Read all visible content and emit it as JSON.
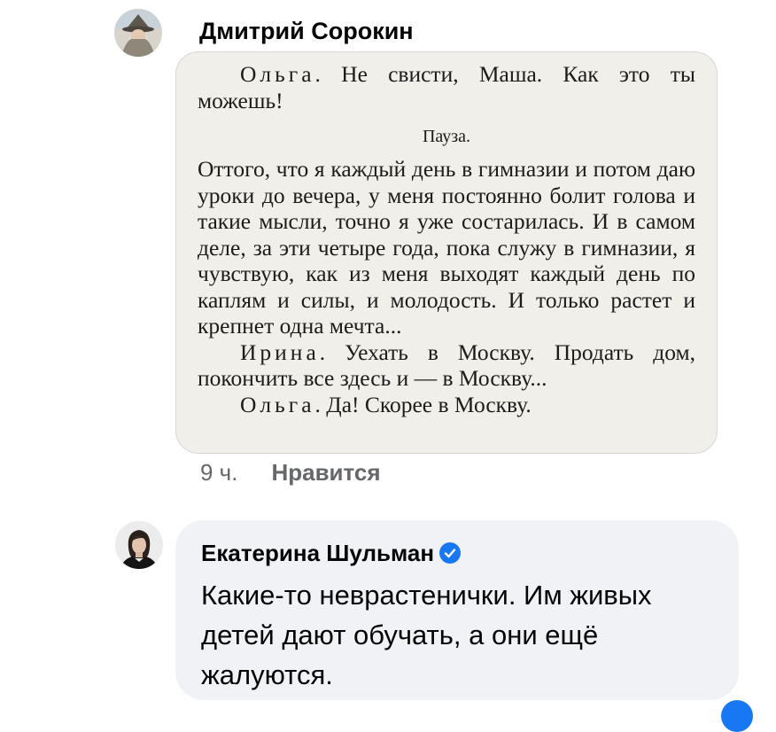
{
  "comment1": {
    "author": "Дмитрий Сорокин",
    "avatar_icon": "wizard-avatar",
    "photo": {
      "line1_speaker": "Ольга",
      "line1_text": ". Не свисти, Маша. Как это ты можешь!",
      "pause": "Пауза.",
      "paragraph": "Оттого, что я каждый день в гимназии и потом даю уроки до вечера, у меня постоянно болит голова и такие мысли, точно я уже состарилась. И в самом деле, за эти четыре года, пока служу в гимназии, я чувствую, как из меня выходят каждый день по каплям и силы, и молодость. И только растет и крепнет одна мечта...",
      "line2_speaker": "Ирина",
      "line2_text": ". Уехать в Москву. Продать дом, покончить все здесь и — в Москву...",
      "line3_speaker": "Ольга",
      "line3_text": ". Да! Скорее в Москву."
    },
    "time": "9 ч.",
    "like_label": "Нравится"
  },
  "comment2": {
    "author": "Екатерина Шульман",
    "avatar_icon": "woman-portrait-avatar",
    "verified_icon": "verified-badge-icon",
    "text": "Какие-то неврастенички. Им живых детей дают обучать, а они ещё жалуются."
  },
  "colors": {
    "accent": "#1877f2",
    "meta_text": "#65676b",
    "bubble_bg": "#f0f2f5"
  }
}
